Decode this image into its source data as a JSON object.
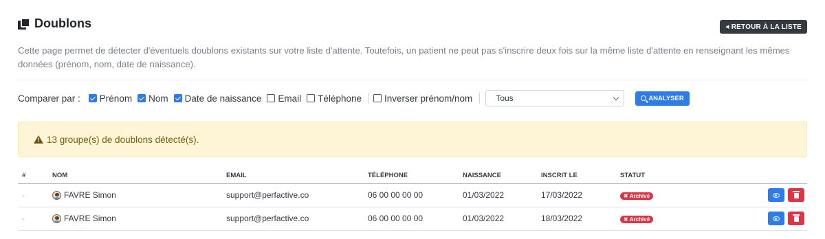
{
  "header": {
    "title": "Doublons",
    "back_button": "RETOUR À LA LISTE"
  },
  "description": "Cette page permet de détecter d'éventuels doublons existants sur votre liste d'attente. Toutefois, un patient ne peut pas s'inscrire deux fois sur la même liste d'attente en renseignant les mêmes données (prénom, nom, date de naissance).",
  "filters": {
    "label": "Comparer par :",
    "options": [
      {
        "label": "Prénom",
        "checked": true
      },
      {
        "label": "Nom",
        "checked": true
      },
      {
        "label": "Date de naissance",
        "checked": true
      },
      {
        "label": "Email",
        "checked": false
      },
      {
        "label": "Téléphone",
        "checked": false
      }
    ],
    "invert": {
      "label": "Inverser prénom/nom",
      "checked": false
    },
    "select_value": "Tous",
    "analyse_button": "ANALYSER"
  },
  "alert": {
    "text": "13 groupe(s) de doublons détecté(s)."
  },
  "table": {
    "headers": [
      "#",
      "NOM",
      "EMAIL",
      "TÉLÉPHONE",
      "NAISSANCE",
      "INSCRIT LE",
      "STATUT"
    ],
    "rows": [
      {
        "num": "-",
        "name": "FAVRE Simon",
        "email": "support@perfactive.co",
        "phone": "06 00 00 00 00",
        "birth": "01/03/2022",
        "registered": "17/03/2022",
        "status": "Archivé"
      },
      {
        "num": "-",
        "name": "FAVRE Simon",
        "email": "support@perfactive.co",
        "phone": "06 00 00 00 00",
        "birth": "01/03/2022",
        "registered": "18/03/2022",
        "status": "Archivé"
      }
    ]
  },
  "colors": {
    "primary": "#2f7be8",
    "danger": "#dc3545",
    "dark": "#343a40",
    "alert_bg": "#fdf5d6"
  }
}
